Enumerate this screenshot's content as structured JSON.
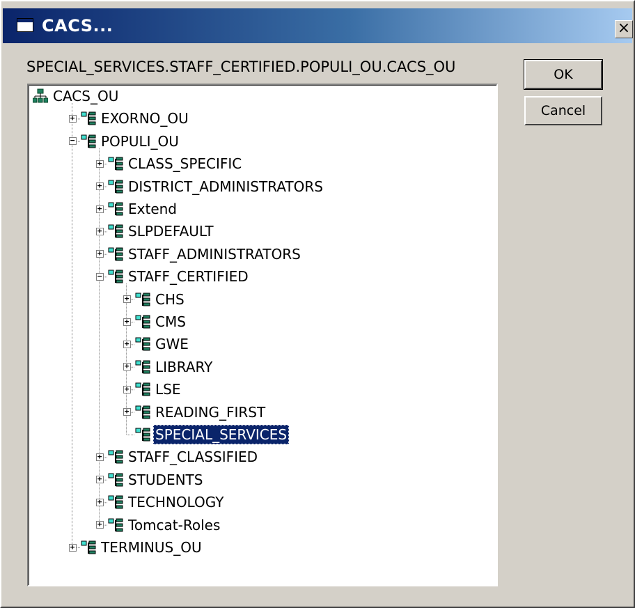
{
  "window": {
    "title": "CACS..."
  },
  "path_label": "SPECIAL_SERVICES.STAFF_CERTIFIED.POPULI_OU.CACS_OU",
  "buttons": {
    "ok": "OK",
    "cancel": "Cancel"
  },
  "colors": {
    "selection": "#0a246a",
    "dialog_face": "#d4d0c8"
  },
  "tree": {
    "nodes": [
      {
        "label": "CACS_OU",
        "depth": 0,
        "icon": "organization-root-icon",
        "expander": "none"
      },
      {
        "label": "EXORNO_OU",
        "depth": 1,
        "icon": "organizational-unit-icon",
        "expander": "plus"
      },
      {
        "label": "POPULI_OU",
        "depth": 1,
        "icon": "organizational-unit-icon",
        "expander": "minus"
      },
      {
        "label": "CLASS_SPECIFIC",
        "depth": 2,
        "icon": "organizational-unit-icon",
        "expander": "plus"
      },
      {
        "label": "DISTRICT_ADMINISTRATORS",
        "depth": 2,
        "icon": "organizational-unit-icon",
        "expander": "plus"
      },
      {
        "label": "Extend",
        "depth": 2,
        "icon": "organizational-unit-icon",
        "expander": "plus"
      },
      {
        "label": "SLPDEFAULT",
        "depth": 2,
        "icon": "organizational-unit-icon",
        "expander": "plus"
      },
      {
        "label": "STAFF_ADMINISTRATORS",
        "depth": 2,
        "icon": "organizational-unit-icon",
        "expander": "plus"
      },
      {
        "label": "STAFF_CERTIFIED",
        "depth": 2,
        "icon": "organizational-unit-icon",
        "expander": "minus"
      },
      {
        "label": "CHS",
        "depth": 3,
        "icon": "organizational-unit-icon",
        "expander": "plus"
      },
      {
        "label": "CMS",
        "depth": 3,
        "icon": "organizational-unit-icon",
        "expander": "plus"
      },
      {
        "label": "GWE",
        "depth": 3,
        "icon": "organizational-unit-icon",
        "expander": "plus"
      },
      {
        "label": "LIBRARY",
        "depth": 3,
        "icon": "organizational-unit-icon",
        "expander": "plus"
      },
      {
        "label": "LSE",
        "depth": 3,
        "icon": "organizational-unit-icon",
        "expander": "plus"
      },
      {
        "label": "READING_FIRST",
        "depth": 3,
        "icon": "organizational-unit-icon",
        "expander": "plus"
      },
      {
        "label": "SPECIAL_SERVICES",
        "depth": 3,
        "icon": "organizational-unit-icon",
        "expander": "none",
        "selected": true
      },
      {
        "label": "STAFF_CLASSIFIED",
        "depth": 2,
        "icon": "organizational-unit-icon",
        "expander": "plus"
      },
      {
        "label": "STUDENTS",
        "depth": 2,
        "icon": "organizational-unit-icon",
        "expander": "plus"
      },
      {
        "label": "TECHNOLOGY",
        "depth": 2,
        "icon": "organizational-unit-icon",
        "expander": "plus"
      },
      {
        "label": "Tomcat-Roles",
        "depth": 2,
        "icon": "organizational-unit-icon",
        "expander": "plus"
      },
      {
        "label": "TERMINUS_OU",
        "depth": 1,
        "icon": "organizational-unit-icon",
        "expander": "plus"
      }
    ]
  }
}
